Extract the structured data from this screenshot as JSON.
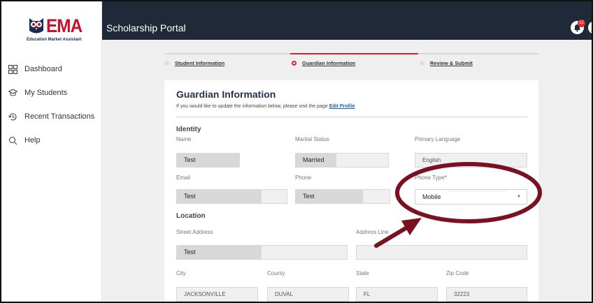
{
  "logo": {
    "text": "EMA",
    "subtitle": "Education Market Assistant"
  },
  "sidebar": {
    "items": [
      {
        "label": "Dashboard",
        "icon": "grid-icon"
      },
      {
        "label": "My Students",
        "icon": "graduation-cap-icon"
      },
      {
        "label": "Recent Transactions",
        "icon": "history-icon"
      },
      {
        "label": "Help",
        "icon": "search-icon"
      }
    ]
  },
  "header": {
    "title": "Scholarship Portal",
    "notification_count": "12"
  },
  "stepper": {
    "steps": [
      {
        "label": "Student Information",
        "active": false
      },
      {
        "label": "Guardian Information",
        "active": true
      },
      {
        "label": "Review & Submit",
        "active": false
      }
    ]
  },
  "form": {
    "title": "Guardian Information",
    "description": "If you would like to update the information below, please visit the page",
    "edit_link": "Edit Profile",
    "identity": {
      "section": "Identity",
      "name_label": "Name",
      "name_value": "Test",
      "marital_label": "Marital Status",
      "marital_value": "Married",
      "language_label": "Primary Language",
      "language_value": "English",
      "email_label": "Email",
      "email_value": "Test",
      "phone_label": "Phone",
      "phone_value": "Test",
      "phone_type_label": "Phone Type",
      "phone_type_required": "*",
      "phone_type_value": "Mobile"
    },
    "location": {
      "section": "Location",
      "street_label": "Street Address",
      "street_value": "Test",
      "address2_label": "Address Line",
      "city_label": "City",
      "city_value": "JACKSONVILLE",
      "county_label": "County",
      "county_value": "DUVAL",
      "state_label": "State",
      "state_value": "FL",
      "zip_label": "Zip Code",
      "zip_value": "32223"
    }
  },
  "colors": {
    "topbar": "#1f2937",
    "accent": "#e11d2d",
    "annotation": "#7a1020",
    "link": "#1a62b0"
  }
}
